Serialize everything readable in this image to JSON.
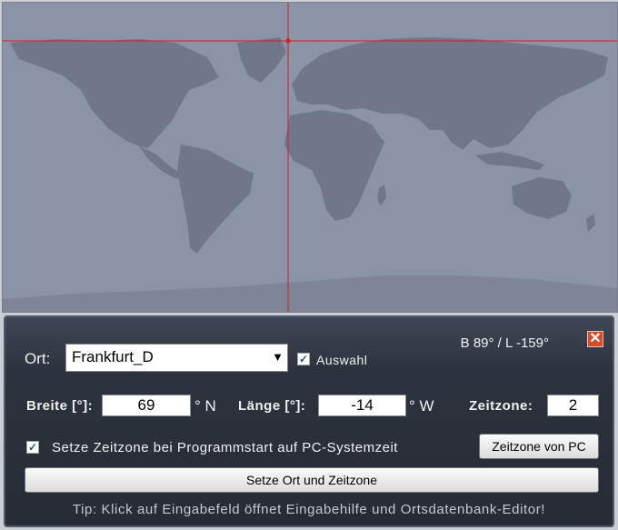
{
  "map": {
    "crosshair_color": "#cc2222",
    "ocean_color": "#8a94a6",
    "land_color": "#6f7789"
  },
  "form": {
    "ort_label": "Ort:",
    "ort_value": "Frankfurt_D",
    "auswahl_label": "Auswahl",
    "auswahl_checked": true,
    "coord_readout": "B 89° / L -159°",
    "close_glyph": "✕",
    "breite_label": "Breite [°]:",
    "breite_value": "69",
    "breite_unit": "° N",
    "laenge_label": "Länge [°]:",
    "laenge_value": "-14",
    "laenge_unit": "° W",
    "zeitzone_label": "Zeitzone:",
    "zeitzone_value": "2",
    "setze_zeitzone_label": "Setze Zeitzone bei Programmstart auf PC-Systemzeit",
    "setze_zeitzone_checked": true,
    "zeitzone_pc_button": "Zeitzone von PC",
    "setze_ort_button": "Setze Ort und Zeitzone",
    "tip": "Tip: Klick auf Eingabefeld öffnet Eingabehilfe und Ortsdatenbank-Editor!"
  }
}
